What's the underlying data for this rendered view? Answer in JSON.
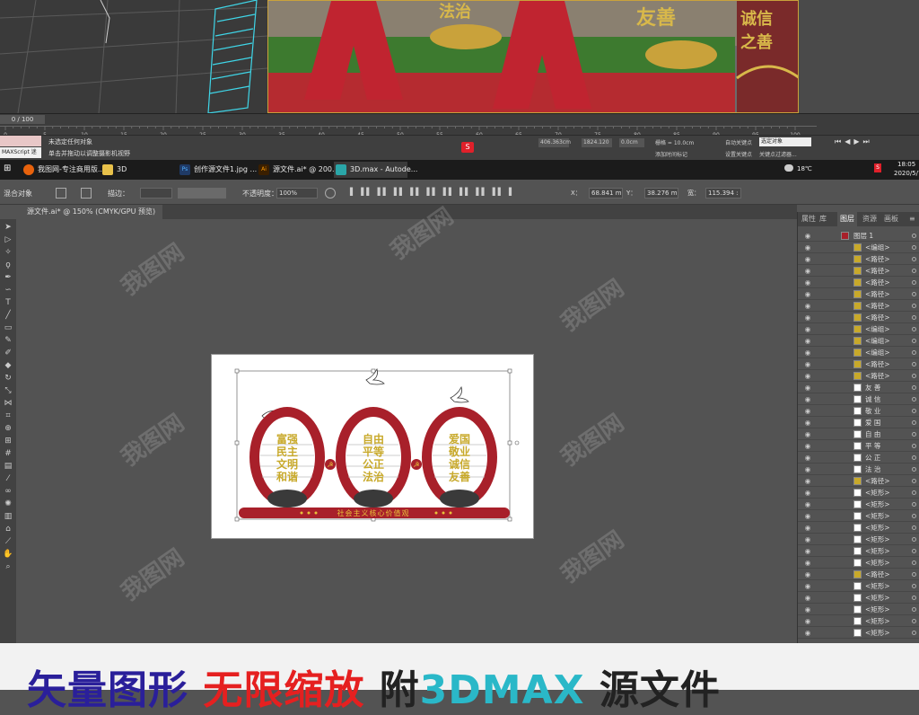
{
  "max": {
    "timeline_counter": "0 / 100",
    "ticks": [
      "0",
      "5",
      "10",
      "15",
      "20",
      "25",
      "30",
      "35",
      "40",
      "45",
      "50",
      "55",
      "60",
      "65",
      "70",
      "75",
      "80",
      "85",
      "90",
      "95",
      "100"
    ],
    "script_label": "MAXScript 迷",
    "status_line1": "未选定任何对象",
    "status_line2": "单击并拖动以调整摄影机视野",
    "x_value": "406.363cm",
    "y_value": "1824.120",
    "z_value": "0.0cm",
    "grid_label": "栅格 = 10.0cm",
    "add_time_tag": "添加时间标记",
    "auto_key": "自动关键点",
    "selected_object": "选定对象",
    "set_key": "设置关键点",
    "key_filters": "关键点过滤器..."
  },
  "taskbar": {
    "items": [
      {
        "label": "我图网-专注商用版...",
        "color": "#e8620c"
      },
      {
        "label": "3D",
        "color": "#e8c14a"
      },
      {
        "label": "创作源文件1.jpg ...",
        "color": "#2c7bd6"
      },
      {
        "label": "源文件.ai* @ 200...",
        "color": "#e07c1c"
      },
      {
        "label": "3D.max - Autode...",
        "color": "#2aa6a8"
      }
    ],
    "temperature": "18℃",
    "time": "18:05",
    "date": "2020/5/7"
  },
  "ai": {
    "selection_label": "混合对象",
    "stroke_label": "描边：",
    "opacity_label": "不透明度：",
    "opacity_value": "100%",
    "x_label": "X：",
    "x_value": "68.841 m",
    "y_label": "Y：",
    "y_value": "38.276 m",
    "w_label": "宽：",
    "w_value": "115.394 :",
    "doc_tab": "源文件.ai* @ 150% (CMYK/GPU 预览)"
  },
  "artboard": {
    "arch_texts": [
      [
        "富强",
        "民主",
        "文明",
        "和谐"
      ],
      [
        "自由",
        "平等",
        "公正",
        "法治"
      ],
      [
        "爱国",
        "敬业",
        "诚信",
        "友善"
      ]
    ],
    "base_text": "社会主义核心价值观",
    "colors": {
      "red": "#a8202a",
      "gold": "#c8a92a"
    }
  },
  "layers": {
    "tabs": [
      "属性",
      "库",
      "图层",
      "资源",
      "画板"
    ],
    "active_tab": "图层",
    "rows": [
      "图层 1",
      "<编组>",
      "<路径>",
      "<路径>",
      "<路径>",
      "<路径>",
      "<路径>",
      "<路径>",
      "<编组>",
      "<编组>",
      "<编组>",
      "<路径>",
      "<路径>",
      "友 善",
      "诚 信",
      "敬 业",
      "爱 国",
      "自 由",
      "平 等",
      "公 正",
      "法 治",
      "<路径>",
      "<矩形>",
      "<矩形>",
      "<矩形>",
      "<矩形>",
      "<矩形>",
      "<矩形>",
      "<矩形>",
      "<路径>",
      "<矩形>",
      "<矩形>",
      "<矩形>",
      "<矩形>",
      "<矩形>"
    ]
  },
  "banner": {
    "text_parts": [
      "矢量图形 ",
      "无限缩放 ",
      "附",
      "3DMAX ",
      "源文件"
    ],
    "colors": [
      "#2a1f9a",
      "#e52020",
      "#222222",
      "#2ab8c8",
      "#222222"
    ]
  },
  "watermark": "我图网"
}
